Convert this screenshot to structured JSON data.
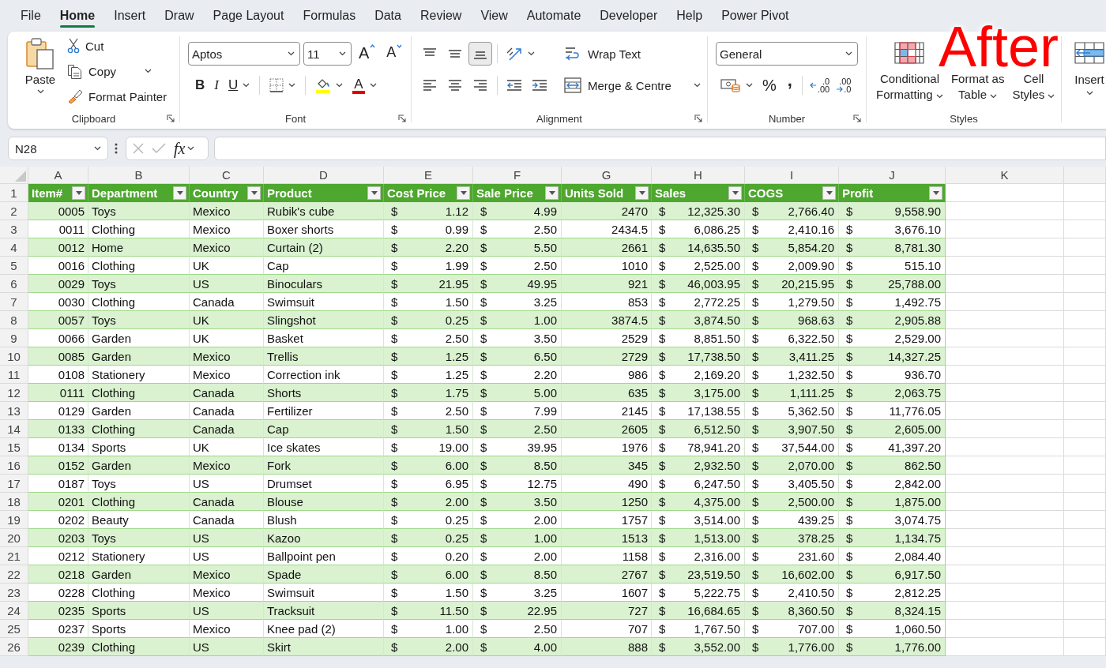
{
  "ribbon": {
    "tabs": [
      {
        "label": "File",
        "selected": false
      },
      {
        "label": "Home",
        "selected": true
      },
      {
        "label": "Insert",
        "selected": false
      },
      {
        "label": "Draw",
        "selected": false
      },
      {
        "label": "Page Layout",
        "selected": false
      },
      {
        "label": "Formulas",
        "selected": false
      },
      {
        "label": "Data",
        "selected": false
      },
      {
        "label": "Review",
        "selected": false
      },
      {
        "label": "View",
        "selected": false
      },
      {
        "label": "Automate",
        "selected": false
      },
      {
        "label": "Developer",
        "selected": false
      },
      {
        "label": "Help",
        "selected": false
      },
      {
        "label": "Power Pivot",
        "selected": false
      }
    ],
    "clipboard": {
      "label": "Clipboard",
      "paste": "Paste",
      "cut": "Cut",
      "copy": "Copy",
      "format_painter": "Format Painter"
    },
    "font": {
      "label": "Font",
      "family": "Aptos",
      "size": "11",
      "grow": "A",
      "shrink": "A",
      "bold": "B",
      "italic": "I",
      "underline": "U",
      "font_color": "A"
    },
    "alignment": {
      "label": "Alignment",
      "vertical": [
        {
          "selected": false
        },
        {
          "selected": false
        },
        {
          "selected": true
        }
      ],
      "wrap_text": "Wrap Text",
      "merge": "Merge & Centre"
    },
    "number": {
      "label": "Number",
      "format": "General",
      "percent": "%",
      "comma": ",",
      "increase_decimal": [
        ".0",
        ".00"
      ],
      "decrease_decimal": [
        ".00",
        ".0"
      ]
    },
    "styles": {
      "label": "Styles",
      "buttons": [
        {
          "kind": "conditional",
          "lines": [
            "Conditional",
            "Formatting"
          ]
        },
        {
          "kind": "table",
          "lines": [
            "Format as",
            "Table"
          ]
        },
        {
          "kind": "cell",
          "lines": [
            "Cell",
            "Styles"
          ]
        }
      ]
    },
    "cells": {
      "insert": "Insert"
    }
  },
  "annotation": "After",
  "formula_bar": {
    "name_box": "N28",
    "function_label": "fx"
  },
  "sheet": {
    "column_letters": [
      "A",
      "B",
      "C",
      "D",
      "E",
      "F",
      "G",
      "H",
      "I",
      "J",
      "K"
    ],
    "row_numbers": [
      "1",
      "2",
      "3",
      "4",
      "5",
      "6",
      "7",
      "8",
      "9",
      "10",
      "11",
      "12",
      "13",
      "14",
      "15",
      "16",
      "17",
      "18",
      "19",
      "20",
      "21",
      "22",
      "23",
      "24",
      "25",
      "26"
    ],
    "table": {
      "banded_rows": true,
      "filter_buttons": true,
      "columns": [
        {
          "label": "Item#",
          "kind": "number"
        },
        {
          "label": "Department",
          "kind": "text"
        },
        {
          "label": "Country",
          "kind": "text"
        },
        {
          "label": "Product",
          "kind": "text"
        },
        {
          "label": "Cost Price",
          "kind": "currency"
        },
        {
          "label": "Sale Price",
          "kind": "currency"
        },
        {
          "label": "Units Sold",
          "kind": "number"
        },
        {
          "label": "Sales",
          "kind": "currency"
        },
        {
          "label": "COGS",
          "kind": "currency"
        },
        {
          "label": "Profit",
          "kind": "currency"
        }
      ],
      "rows": [
        [
          "0005",
          "Toys",
          "Mexico",
          "Rubik's cube",
          {
            "symbol": "$",
            "amount": "1.12"
          },
          {
            "symbol": "$",
            "amount": "4.99"
          },
          "2470",
          {
            "symbol": "$",
            "amount": "12,325.30"
          },
          {
            "symbol": "$",
            "amount": "2,766.40"
          },
          {
            "symbol": "$",
            "amount": "9,558.90"
          }
        ],
        [
          "0011",
          "Clothing",
          "Mexico",
          "Boxer shorts",
          {
            "symbol": "$",
            "amount": "0.99"
          },
          {
            "symbol": "$",
            "amount": "2.50"
          },
          "2434.5",
          {
            "symbol": "$",
            "amount": "6,086.25"
          },
          {
            "symbol": "$",
            "amount": "2,410.16"
          },
          {
            "symbol": "$",
            "amount": "3,676.10"
          }
        ],
        [
          "0012",
          "Home",
          "Mexico",
          "Curtain (2)",
          {
            "symbol": "$",
            "amount": "2.20"
          },
          {
            "symbol": "$",
            "amount": "5.50"
          },
          "2661",
          {
            "symbol": "$",
            "amount": "14,635.50"
          },
          {
            "symbol": "$",
            "amount": "5,854.20"
          },
          {
            "symbol": "$",
            "amount": "8,781.30"
          }
        ],
        [
          "0016",
          "Clothing",
          "UK",
          "Cap",
          {
            "symbol": "$",
            "amount": "1.99"
          },
          {
            "symbol": "$",
            "amount": "2.50"
          },
          "1010",
          {
            "symbol": "$",
            "amount": "2,525.00"
          },
          {
            "symbol": "$",
            "amount": "2,009.90"
          },
          {
            "symbol": "$",
            "amount": "515.10"
          }
        ],
        [
          "0029",
          "Toys",
          "US",
          "Binoculars",
          {
            "symbol": "$",
            "amount": "21.95"
          },
          {
            "symbol": "$",
            "amount": "49.95"
          },
          "921",
          {
            "symbol": "$",
            "amount": "46,003.95"
          },
          {
            "symbol": "$",
            "amount": "20,215.95"
          },
          {
            "symbol": "$",
            "amount": "25,788.00"
          }
        ],
        [
          "0030",
          "Clothing",
          "Canada",
          "Swimsuit",
          {
            "symbol": "$",
            "amount": "1.50"
          },
          {
            "symbol": "$",
            "amount": "3.25"
          },
          "853",
          {
            "symbol": "$",
            "amount": "2,772.25"
          },
          {
            "symbol": "$",
            "amount": "1,279.50"
          },
          {
            "symbol": "$",
            "amount": "1,492.75"
          }
        ],
        [
          "0057",
          "Toys",
          "UK",
          "Slingshot",
          {
            "symbol": "$",
            "amount": "0.25"
          },
          {
            "symbol": "$",
            "amount": "1.00"
          },
          "3874.5",
          {
            "symbol": "$",
            "amount": "3,874.50"
          },
          {
            "symbol": "$",
            "amount": "968.63"
          },
          {
            "symbol": "$",
            "amount": "2,905.88"
          }
        ],
        [
          "0066",
          "Garden",
          "UK",
          "Basket",
          {
            "symbol": "$",
            "amount": "2.50"
          },
          {
            "symbol": "$",
            "amount": "3.50"
          },
          "2529",
          {
            "symbol": "$",
            "amount": "8,851.50"
          },
          {
            "symbol": "$",
            "amount": "6,322.50"
          },
          {
            "symbol": "$",
            "amount": "2,529.00"
          }
        ],
        [
          "0085",
          "Garden",
          "Mexico",
          "Trellis",
          {
            "symbol": "$",
            "amount": "1.25"
          },
          {
            "symbol": "$",
            "amount": "6.50"
          },
          "2729",
          {
            "symbol": "$",
            "amount": "17,738.50"
          },
          {
            "symbol": "$",
            "amount": "3,411.25"
          },
          {
            "symbol": "$",
            "amount": "14,327.25"
          }
        ],
        [
          "0108",
          "Stationery",
          "Mexico",
          "Correction ink",
          {
            "symbol": "$",
            "amount": "1.25"
          },
          {
            "symbol": "$",
            "amount": "2.20"
          },
          "986",
          {
            "symbol": "$",
            "amount": "2,169.20"
          },
          {
            "symbol": "$",
            "amount": "1,232.50"
          },
          {
            "symbol": "$",
            "amount": "936.70"
          }
        ],
        [
          "0111",
          "Clothing",
          "Canada",
          "Shorts",
          {
            "symbol": "$",
            "amount": "1.75"
          },
          {
            "symbol": "$",
            "amount": "5.00"
          },
          "635",
          {
            "symbol": "$",
            "amount": "3,175.00"
          },
          {
            "symbol": "$",
            "amount": "1,111.25"
          },
          {
            "symbol": "$",
            "amount": "2,063.75"
          }
        ],
        [
          "0129",
          "Garden",
          "Canada",
          "Fertilizer",
          {
            "symbol": "$",
            "amount": "2.50"
          },
          {
            "symbol": "$",
            "amount": "7.99"
          },
          "2145",
          {
            "symbol": "$",
            "amount": "17,138.55"
          },
          {
            "symbol": "$",
            "amount": "5,362.50"
          },
          {
            "symbol": "$",
            "amount": "11,776.05"
          }
        ],
        [
          "0133",
          "Clothing",
          "Canada",
          "Cap",
          {
            "symbol": "$",
            "amount": "1.50"
          },
          {
            "symbol": "$",
            "amount": "2.50"
          },
          "2605",
          {
            "symbol": "$",
            "amount": "6,512.50"
          },
          {
            "symbol": "$",
            "amount": "3,907.50"
          },
          {
            "symbol": "$",
            "amount": "2,605.00"
          }
        ],
        [
          "0134",
          "Sports",
          "UK",
          "Ice skates",
          {
            "symbol": "$",
            "amount": "19.00"
          },
          {
            "symbol": "$",
            "amount": "39.95"
          },
          "1976",
          {
            "symbol": "$",
            "amount": "78,941.20"
          },
          {
            "symbol": "$",
            "amount": "37,544.00"
          },
          {
            "symbol": "$",
            "amount": "41,397.20"
          }
        ],
        [
          "0152",
          "Garden",
          "Mexico",
          "Fork",
          {
            "symbol": "$",
            "amount": "6.00"
          },
          {
            "symbol": "$",
            "amount": "8.50"
          },
          "345",
          {
            "symbol": "$",
            "amount": "2,932.50"
          },
          {
            "symbol": "$",
            "amount": "2,070.00"
          },
          {
            "symbol": "$",
            "amount": "862.50"
          }
        ],
        [
          "0187",
          "Toys",
          "US",
          "Drumset",
          {
            "symbol": "$",
            "amount": "6.95"
          },
          {
            "symbol": "$",
            "amount": "12.75"
          },
          "490",
          {
            "symbol": "$",
            "amount": "6,247.50"
          },
          {
            "symbol": "$",
            "amount": "3,405.50"
          },
          {
            "symbol": "$",
            "amount": "2,842.00"
          }
        ],
        [
          "0201",
          "Clothing",
          "Canada",
          "Blouse",
          {
            "symbol": "$",
            "amount": "2.00"
          },
          {
            "symbol": "$",
            "amount": "3.50"
          },
          "1250",
          {
            "symbol": "$",
            "amount": "4,375.00"
          },
          {
            "symbol": "$",
            "amount": "2,500.00"
          },
          {
            "symbol": "$",
            "amount": "1,875.00"
          }
        ],
        [
          "0202",
          "Beauty",
          "Canada",
          "Blush",
          {
            "symbol": "$",
            "amount": "0.25"
          },
          {
            "symbol": "$",
            "amount": "2.00"
          },
          "1757",
          {
            "symbol": "$",
            "amount": "3,514.00"
          },
          {
            "symbol": "$",
            "amount": "439.25"
          },
          {
            "symbol": "$",
            "amount": "3,074.75"
          }
        ],
        [
          "0203",
          "Toys",
          "US",
          "Kazoo",
          {
            "symbol": "$",
            "amount": "0.25"
          },
          {
            "symbol": "$",
            "amount": "1.00"
          },
          "1513",
          {
            "symbol": "$",
            "amount": "1,513.00"
          },
          {
            "symbol": "$",
            "amount": "378.25"
          },
          {
            "symbol": "$",
            "amount": "1,134.75"
          }
        ],
        [
          "0212",
          "Stationery",
          "US",
          "Ballpoint pen",
          {
            "symbol": "$",
            "amount": "0.20"
          },
          {
            "symbol": "$",
            "amount": "2.00"
          },
          "1158",
          {
            "symbol": "$",
            "amount": "2,316.00"
          },
          {
            "symbol": "$",
            "amount": "231.60"
          },
          {
            "symbol": "$",
            "amount": "2,084.40"
          }
        ],
        [
          "0218",
          "Garden",
          "Mexico",
          "Spade",
          {
            "symbol": "$",
            "amount": "6.00"
          },
          {
            "symbol": "$",
            "amount": "8.50"
          },
          "2767",
          {
            "symbol": "$",
            "amount": "23,519.50"
          },
          {
            "symbol": "$",
            "amount": "16,602.00"
          },
          {
            "symbol": "$",
            "amount": "6,917.50"
          }
        ],
        [
          "0228",
          "Clothing",
          "Mexico",
          "Swimsuit",
          {
            "symbol": "$",
            "amount": "1.50"
          },
          {
            "symbol": "$",
            "amount": "3.25"
          },
          "1607",
          {
            "symbol": "$",
            "amount": "5,222.75"
          },
          {
            "symbol": "$",
            "amount": "2,410.50"
          },
          {
            "symbol": "$",
            "amount": "2,812.25"
          }
        ],
        [
          "0235",
          "Sports",
          "US",
          "Tracksuit",
          {
            "symbol": "$",
            "amount": "11.50"
          },
          {
            "symbol": "$",
            "amount": "22.95"
          },
          "727",
          {
            "symbol": "$",
            "amount": "16,684.65"
          },
          {
            "symbol": "$",
            "amount": "8,360.50"
          },
          {
            "symbol": "$",
            "amount": "8,324.15"
          }
        ],
        [
          "0237",
          "Sports",
          "Mexico",
          "Knee pad (2)",
          {
            "symbol": "$",
            "amount": "1.00"
          },
          {
            "symbol": "$",
            "amount": "2.50"
          },
          "707",
          {
            "symbol": "$",
            "amount": "1,767.50"
          },
          {
            "symbol": "$",
            "amount": "707.00"
          },
          {
            "symbol": "$",
            "amount": "1,060.50"
          }
        ],
        [
          "0239",
          "Clothing",
          "US",
          "Skirt",
          {
            "symbol": "$",
            "amount": "2.00"
          },
          {
            "symbol": "$",
            "amount": "4.00"
          },
          "888",
          {
            "symbol": "$",
            "amount": "3,552.00"
          },
          {
            "symbol": "$",
            "amount": "1,776.00"
          },
          {
            "symbol": "$",
            "amount": "1,776.00"
          }
        ]
      ]
    }
  }
}
